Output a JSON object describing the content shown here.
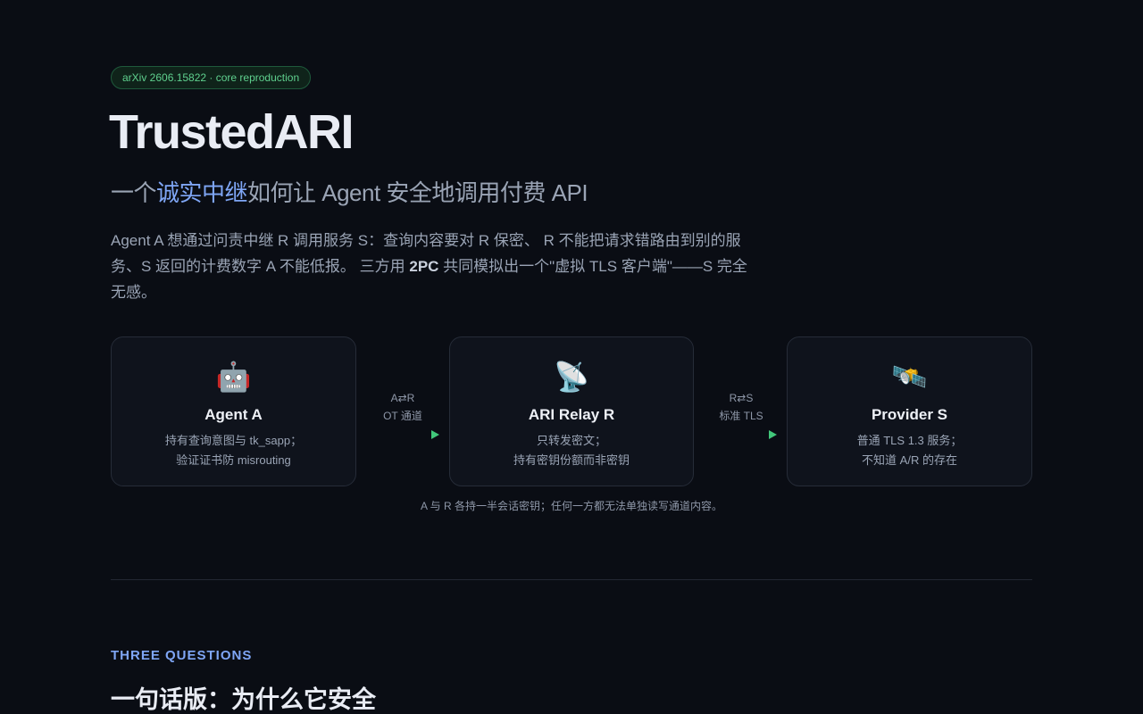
{
  "badge": "arXiv 2606.15822 · core reproduction",
  "hero": {
    "title": "TrustedARI",
    "subtitle_pre": "一个",
    "subtitle_highlight": "诚实中继",
    "subtitle_post": "如何让 Agent 安全地调用付费 API",
    "desc_pre": "Agent A 想通过问责中继 R 调用服务 S：查询内容要对 R 保密、 R 不能把请求错路由到别的服务、S 返回的计费数字 A 不能低报。 三方用 ",
    "desc_bold": "2PC",
    "desc_post": " 共同模拟出一个\"虚拟 TLS 客户端\"——S 完全无感。"
  },
  "nodes": [
    {
      "emoji": "🤖",
      "name": "Agent A",
      "line1": "持有查询意图与 tk_sapp；",
      "line2": "验证证书防 misrouting"
    },
    {
      "emoji": "📡",
      "name": "ARI Relay R",
      "line1": "只转发密文；",
      "line2": "持有密钥份额而非密钥"
    },
    {
      "emoji": "🛰️",
      "name": "Provider S",
      "line1": "普通 TLS 1.3 服务；",
      "line2": "不知道 A/R 的存在"
    }
  ],
  "links": [
    {
      "top": "A⇄R",
      "bottom": "OT 通道"
    },
    {
      "top": "R⇄S",
      "bottom": "标准 TLS"
    }
  ],
  "caption": "A 与 R 各持一半会话密钥；任何一方都无法单独读写通道内容。",
  "section": {
    "label": "THREE QUESTIONS",
    "title": "一句话版：为什么它安全"
  },
  "colors": {
    "background": "#0a0d14",
    "accent_blue": "#7fa6f5",
    "accent_green": "#41c77a"
  }
}
